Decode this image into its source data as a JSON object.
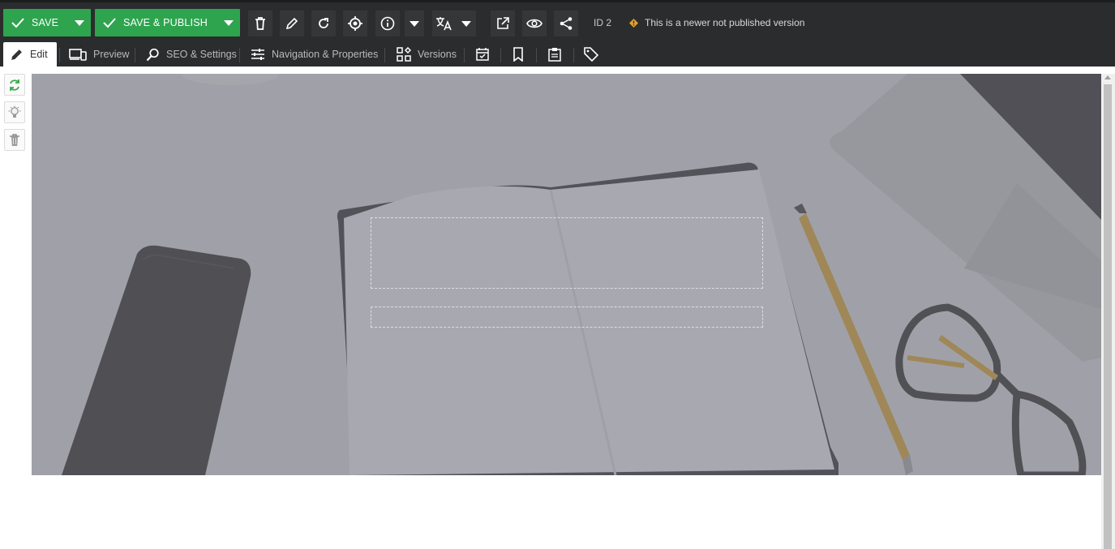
{
  "toolbar": {
    "save_label": "SAVE",
    "save_publish_label": "SAVE & PUBLISH",
    "id_label": "ID 2",
    "notice": "This is a newer not published version"
  },
  "tabs": [
    {
      "label": "Edit",
      "icon": "pencil-icon"
    },
    {
      "label": "Preview",
      "icon": "devices-icon"
    },
    {
      "label": "SEO & Settings",
      "icon": "search-settings-icon"
    },
    {
      "label": "Navigation & Properties",
      "icon": "sliders-icon"
    },
    {
      "label": "Versions",
      "icon": "grid-icon"
    },
    {
      "label": "",
      "icon": "calendar-check-icon"
    },
    {
      "label": "",
      "icon": "bookmark-icon"
    },
    {
      "label": "",
      "icon": "clipboard-icon"
    },
    {
      "label": "",
      "icon": "tag-icon"
    }
  ],
  "colors": {
    "toolbar_bg": "#2b2c2d",
    "save_green": "#2ea44f",
    "notice_icon": "#e0a030",
    "hero_overlay": "#7e7f86"
  }
}
